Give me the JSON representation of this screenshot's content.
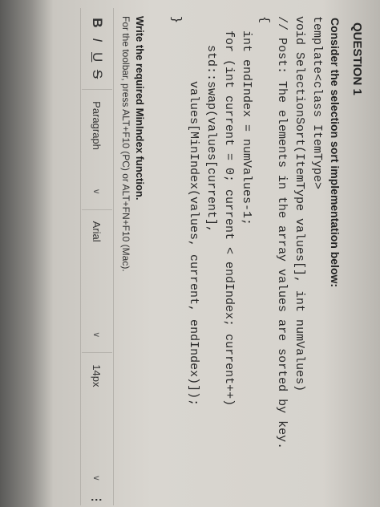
{
  "question": {
    "title": "QUESTION 1",
    "prompt": "Consider the selection sort implementation below:"
  },
  "code": {
    "lines": [
      "template<class ItemType>",
      "void SelectionSort(ItemType values[], int numValues)",
      "// Post: The elements in the array values are sorted by key.",
      "{",
      "  int endIndex = numValues-1;",
      "  for (int current = 0; current < endIndex; current++)",
      "    std::swap(values[current],",
      "         values[MinIndex(values, current, endIndex)]);",
      "}"
    ]
  },
  "task": {
    "text": "Write the required MinIndex function.",
    "hint": "For the toolbar, press ALT+F10 (PC) or ALT+FN+F10 (Mac)."
  },
  "toolbar": {
    "bold": "B",
    "italic": "I",
    "underline": "U",
    "strike": "S",
    "paragraph": "Paragraph",
    "font": "Arial",
    "size": "14px",
    "more": "⋮"
  }
}
